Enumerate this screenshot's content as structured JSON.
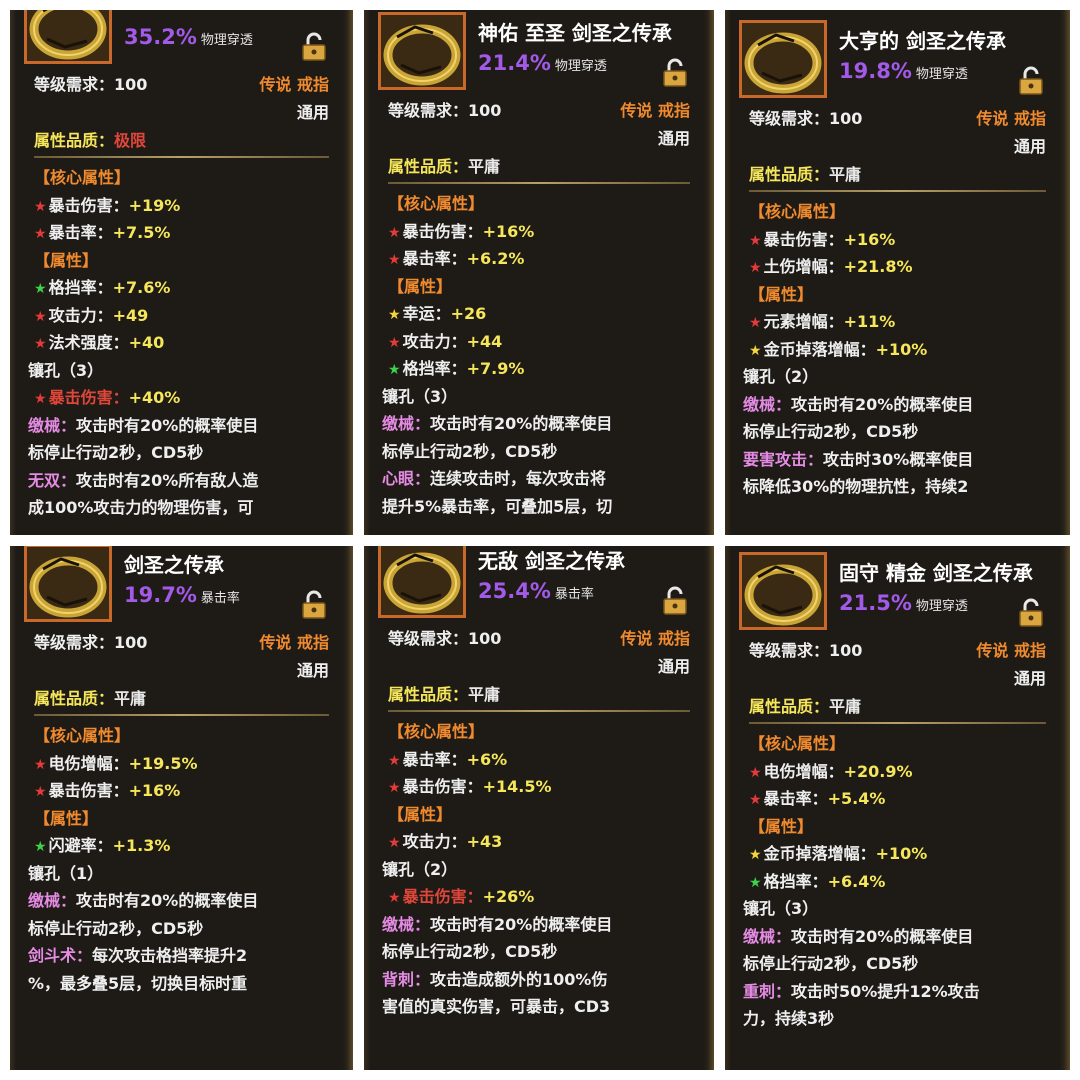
{
  "cards": [
    {
      "title": "",
      "percent": "35.2%",
      "percent_stat": "物理穿透",
      "level_label": "等级需求：",
      "level_value": "100",
      "rarity": "传说 戒指",
      "class": "通用",
      "quality_label": "属性品质：",
      "quality_value": "极限",
      "core_header": "【核心属性】",
      "core": [
        {
          "star": "red",
          "name": "暴击伤害：",
          "value": "+19%"
        },
        {
          "star": "red",
          "name": "暴击率：",
          "value": "+7.5%"
        }
      ],
      "attr_header": "【属性】",
      "attrs": [
        {
          "star": "green",
          "name": "格挡率：",
          "value": "+7.6%"
        },
        {
          "star": "red",
          "name": "攻击力：",
          "value": "+49"
        },
        {
          "star": "red",
          "name": "法术强度：",
          "value": "+40"
        }
      ],
      "socket": "镶孔（3）",
      "socket_line": {
        "star": "red",
        "name": "暴击伤害：",
        "value": "+40%"
      },
      "skills": [
        {
          "name": "缴械：",
          "desc": "攻击时有20%的概率使目",
          "cont": "标停止行动2秒，CD5秒"
        },
        {
          "name": "无双：",
          "desc": "攻击时有20%所有敌人造",
          "cont": "成100%攻击力的物理伤害，可"
        }
      ]
    },
    {
      "title": "神佑 至圣 剑圣之传承",
      "percent": "21.4%",
      "percent_stat": "物理穿透",
      "level_label": "等级需求：",
      "level_value": "100",
      "rarity": "传说 戒指",
      "class": "通用",
      "quality_label": "属性品质：",
      "quality_value": "平庸",
      "core_header": "【核心属性】",
      "core": [
        {
          "star": "red",
          "name": "暴击伤害：",
          "value": "+16%"
        },
        {
          "star": "red",
          "name": "暴击率：",
          "value": "+6.2%"
        }
      ],
      "attr_header": "【属性】",
      "attrs": [
        {
          "star": "yellow",
          "name": "幸运：",
          "value": "+26"
        },
        {
          "star": "red",
          "name": "攻击力：",
          "value": "+44"
        },
        {
          "star": "green",
          "name": "格挡率：",
          "value": "+7.9%"
        }
      ],
      "socket": "镶孔（3）",
      "socket_line": null,
      "skills": [
        {
          "name": "缴械：",
          "desc": "攻击时有20%的概率使目",
          "cont": "标停止行动2秒，CD5秒"
        },
        {
          "name": "心眼：",
          "desc": "连续攻击时，每次攻击将",
          "cont": "提升5%暴击率，可叠加5层，切"
        }
      ]
    },
    {
      "title": "大亨的 剑圣之传承",
      "percent": "19.8%",
      "percent_stat": "物理穿透",
      "level_label": "等级需求：",
      "level_value": "100",
      "rarity": "传说 戒指",
      "class": "通用",
      "quality_label": "属性品质：",
      "quality_value": "平庸",
      "core_header": "【核心属性】",
      "core": [
        {
          "star": "red",
          "name": "暴击伤害：",
          "value": "+16%"
        },
        {
          "star": "red",
          "name": "土伤增幅：",
          "value": "+21.8%"
        }
      ],
      "attr_header": "【属性】",
      "attrs": [
        {
          "star": "red",
          "name": "元素增幅：",
          "value": "+11%"
        },
        {
          "star": "yellow",
          "name": "金币掉落增幅：",
          "value": "+10%"
        }
      ],
      "socket": "镶孔（2）",
      "socket_line": null,
      "skills": [
        {
          "name": "缴械：",
          "desc": "攻击时有20%的概率使目",
          "cont": "标停止行动2秒，CD5秒"
        },
        {
          "name": "要害攻击：",
          "desc": "攻击时30%概率使目",
          "cont": "标降低30%的物理抗性，持续2"
        }
      ]
    },
    {
      "title": "剑圣之传承",
      "percent": "19.7%",
      "percent_stat": "暴击率",
      "level_label": "等级需求：",
      "level_value": "100",
      "rarity": "传说 戒指",
      "class": "通用",
      "quality_label": "属性品质：",
      "quality_value": "平庸",
      "core_header": "【核心属性】",
      "core": [
        {
          "star": "red",
          "name": "电伤增幅：",
          "value": "+19.5%"
        },
        {
          "star": "red",
          "name": "暴击伤害：",
          "value": "+16%"
        }
      ],
      "attr_header": "【属性】",
      "attrs": [
        {
          "star": "green",
          "name": "闪避率：",
          "value": "+1.3%"
        }
      ],
      "socket": "镶孔（1）",
      "socket_line": null,
      "skills": [
        {
          "name": "缴械：",
          "desc": "攻击时有20%的概率使目",
          "cont": "标停止行动2秒，CD5秒"
        },
        {
          "name": "剑斗术：",
          "desc": "每次攻击格挡率提升2",
          "cont": "%，最多叠5层，切换目标时重"
        }
      ]
    },
    {
      "title": "无敌 剑圣之传承",
      "percent": "25.4%",
      "percent_stat": "暴击率",
      "level_label": "等级需求：",
      "level_value": "100",
      "rarity": "传说 戒指",
      "class": "通用",
      "quality_label": "属性品质：",
      "quality_value": "平庸",
      "core_header": "【核心属性】",
      "core": [
        {
          "star": "red",
          "name": "暴击率：",
          "value": "+6%"
        },
        {
          "star": "red",
          "name": "暴击伤害：",
          "value": "+14.5%"
        }
      ],
      "attr_header": "【属性】",
      "attrs": [
        {
          "star": "red",
          "name": "攻击力：",
          "value": "+43"
        }
      ],
      "socket": "镶孔（2）",
      "socket_line": {
        "star": "red",
        "name": "暴击伤害：",
        "value": "+26%"
      },
      "skills": [
        {
          "name": "缴械：",
          "desc": "攻击时有20%的概率使目",
          "cont": "标停止行动2秒，CD5秒"
        },
        {
          "name": "背刺：",
          "desc": "攻击造成额外的100%伤",
          "cont": "害值的真实伤害，可暴击，CD3"
        }
      ]
    },
    {
      "title": "固守 精金 剑圣之传承",
      "percent": "21.5%",
      "percent_stat": "物理穿透",
      "level_label": "等级需求：",
      "level_value": "100",
      "rarity": "传说 戒指",
      "class": "通用",
      "quality_label": "属性品质：",
      "quality_value": "平庸",
      "core_header": "【核心属性】",
      "core": [
        {
          "star": "red",
          "name": "电伤增幅：",
          "value": "+20.9%"
        },
        {
          "star": "red",
          "name": "暴击率：",
          "value": "+5.4%"
        }
      ],
      "attr_header": "【属性】",
      "attrs": [
        {
          "star": "yellow",
          "name": "金币掉落增幅：",
          "value": "+10%"
        },
        {
          "star": "green",
          "name": "格挡率：",
          "value": "+6.4%"
        }
      ],
      "socket": "镶孔（3）",
      "socket_line": null,
      "skills": [
        {
          "name": "缴械：",
          "desc": "攻击时有20%的概率使目",
          "cont": "标停止行动2秒，CD5秒"
        },
        {
          "name": "重刺：",
          "desc": "攻击时50%提升12%攻击",
          "cont": "力，持续3秒"
        }
      ]
    }
  ]
}
